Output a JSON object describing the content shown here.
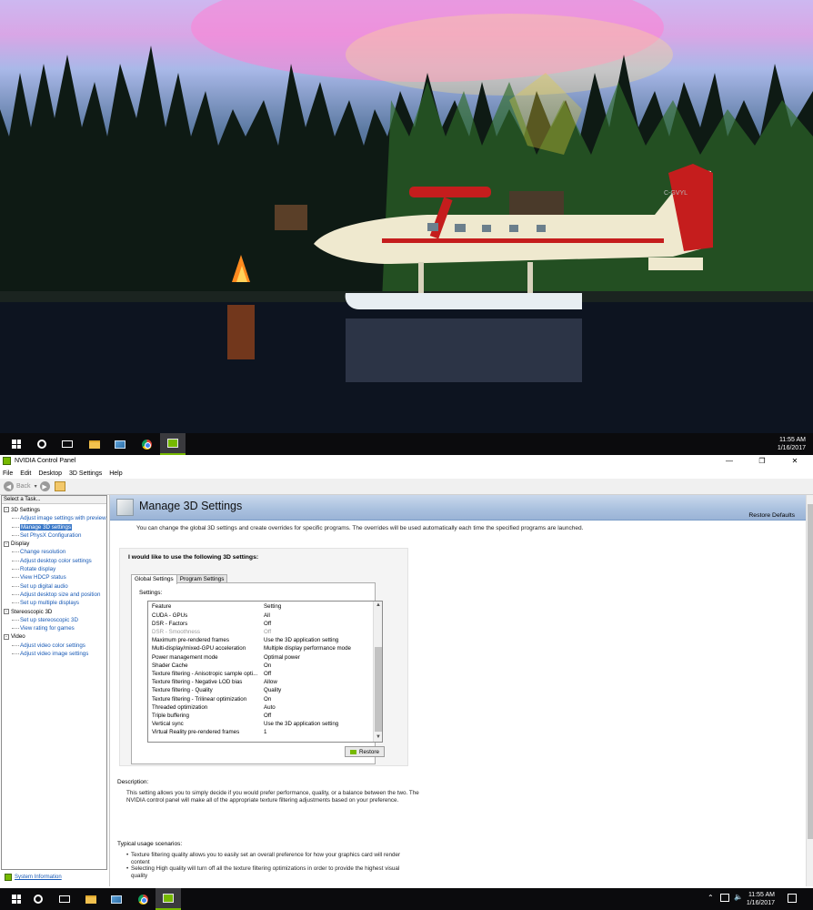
{
  "desktop": {
    "wallpaper": "float plane on lake at dusk",
    "plane_registration": "C-GVYL"
  },
  "taskbar_top": {
    "time": "11:55 AM",
    "date": "1/16/2017",
    "apps": [
      "windows-start",
      "cortana-search",
      "task-view",
      "file-explorer",
      "photos",
      "chrome",
      "nvidia-control-panel"
    ]
  },
  "window": {
    "title": "NVIDIA Control Panel",
    "menu": [
      "File",
      "Edit",
      "Desktop",
      "3D Settings",
      "Help"
    ],
    "toolbar": {
      "back_label": "Back"
    },
    "task_panel": {
      "header": "Select a Task...",
      "tree": [
        {
          "type": "cat",
          "label": "3D Settings"
        },
        {
          "type": "sub",
          "label": "Adjust image settings with preview"
        },
        {
          "type": "sub",
          "label": "Manage 3D settings",
          "selected": true
        },
        {
          "type": "sub",
          "label": "Set PhysX Configuration"
        },
        {
          "type": "cat",
          "label": "Display"
        },
        {
          "type": "sub",
          "label": "Change resolution"
        },
        {
          "type": "sub",
          "label": "Adjust desktop color settings"
        },
        {
          "type": "sub",
          "label": "Rotate display"
        },
        {
          "type": "sub",
          "label": "View HDCP status"
        },
        {
          "type": "sub",
          "label": "Set up digital audio"
        },
        {
          "type": "sub",
          "label": "Adjust desktop size and position"
        },
        {
          "type": "sub",
          "label": "Set up multiple displays"
        },
        {
          "type": "cat",
          "label": "Stereoscopic 3D"
        },
        {
          "type": "sub",
          "label": "Set up stereoscopic 3D"
        },
        {
          "type": "sub",
          "label": "View rating for games"
        },
        {
          "type": "cat",
          "label": "Video"
        },
        {
          "type": "sub",
          "label": "Adjust video color settings"
        },
        {
          "type": "sub",
          "label": "Adjust video image settings"
        }
      ],
      "system_info": "System Information"
    },
    "page": {
      "title": "Manage 3D Settings",
      "restore_defaults": "Restore Defaults",
      "intro": "You can change the global 3D settings and create overrides for specific programs. The overrides will be used automatically each time the specified programs are launched.",
      "group_title": "I would like to use the following 3D settings:",
      "tabs": [
        "Global Settings",
        "Program Settings"
      ],
      "settings_label": "Settings:",
      "columns": [
        "Feature",
        "Setting"
      ],
      "rows": [
        {
          "feature": "CUDA - GPUs",
          "setting": "All"
        },
        {
          "feature": "DSR - Factors",
          "setting": "Off"
        },
        {
          "feature": "DSR - Smoothness",
          "setting": "Off",
          "disabled": true
        },
        {
          "feature": "Maximum pre-rendered frames",
          "setting": "Use the 3D application setting"
        },
        {
          "feature": "Multi-display/mixed-GPU acceleration",
          "setting": "Multiple display performance mode"
        },
        {
          "feature": "Power management mode",
          "setting": "Optimal power"
        },
        {
          "feature": "Shader Cache",
          "setting": "On"
        },
        {
          "feature": "Texture filtering - Anisotropic sample opti...",
          "setting": "Off"
        },
        {
          "feature": "Texture filtering - Negative LOD bias",
          "setting": "Allow"
        },
        {
          "feature": "Texture filtering - Quality",
          "setting": "Quality"
        },
        {
          "feature": "Texture filtering - Trilinear optimization",
          "setting": "On"
        },
        {
          "feature": "Threaded optimization",
          "setting": "Auto"
        },
        {
          "feature": "Triple buffering",
          "setting": "Off"
        },
        {
          "feature": "Vertical sync",
          "setting": "Use the 3D application setting"
        },
        {
          "feature": "Virtual Reality pre-rendered frames",
          "setting": "1"
        }
      ],
      "restore_button": "Restore",
      "description_title": "Description:",
      "description": "This setting allows you to simply decide if you would prefer performance, quality, or a balance between the two. The NVIDIA control panel will make all of the appropriate texture filtering adjustments based on your preference.",
      "typical_title": "Typical usage scenarios:",
      "typical": [
        "Texture filtering quality allows you to easily set an overall preference for how your graphics card will render content",
        "Selecting High quality will turn off all the texture filtering optimizations in order to provide the highest visual quality"
      ]
    }
  },
  "taskbar_bottom": {
    "time": "11:55 AM",
    "date": "1/16/2017"
  },
  "colors": {
    "nvidia_green": "#76b900",
    "link_blue": "#1759b5",
    "selection": "#3a78c8"
  }
}
